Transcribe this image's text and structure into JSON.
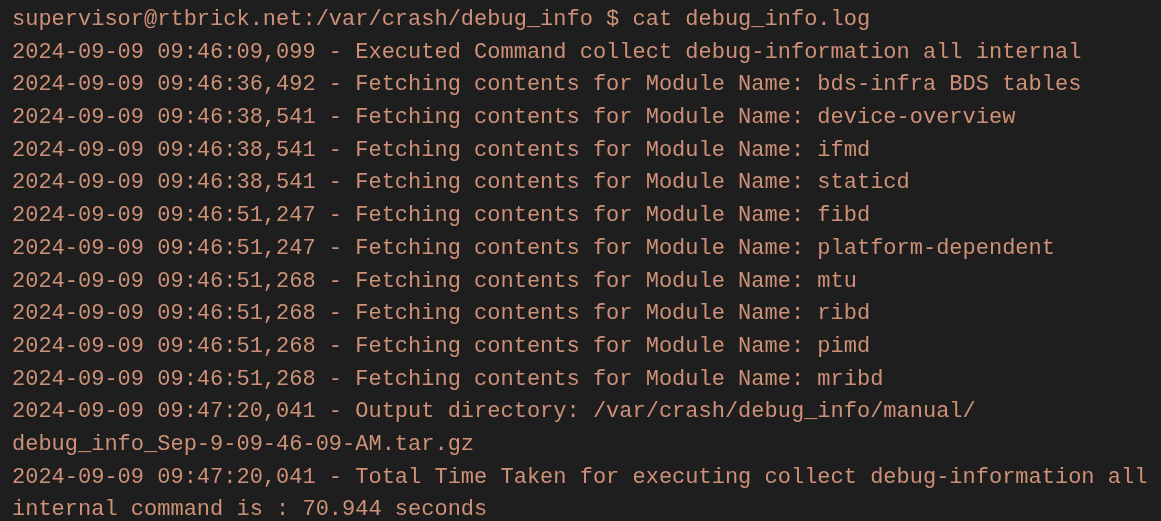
{
  "terminal": {
    "lines": [
      "supervisor@rtbrick.net:/var/crash/debug_info $ cat debug_info.log",
      "2024-09-09 09:46:09,099 - Executed Command collect debug-information all internal",
      "2024-09-09 09:46:36,492 - Fetching contents for Module Name: bds-infra BDS tables",
      "2024-09-09 09:46:38,541 - Fetching contents for Module Name: device-overview",
      "2024-09-09 09:46:38,541 - Fetching contents for Module Name: ifmd",
      "2024-09-09 09:46:38,541 - Fetching contents for Module Name: staticd",
      "2024-09-09 09:46:51,247 - Fetching contents for Module Name: fibd",
      "2024-09-09 09:46:51,247 - Fetching contents for Module Name: platform-dependent",
      "2024-09-09 09:46:51,268 - Fetching contents for Module Name: mtu",
      "2024-09-09 09:46:51,268 - Fetching contents for Module Name: ribd",
      "2024-09-09 09:46:51,268 - Fetching contents for Module Name: pimd",
      "2024-09-09 09:46:51,268 - Fetching contents for Module Name: mribd",
      "2024-09-09 09:47:20,041 - Output directory: /var/crash/debug_info/manual/",
      "debug_info_Sep-9-09-46-09-AM.tar.gz",
      "2024-09-09 09:47:20,041 - Total Time Taken for executing collect debug-information all",
      "internal command is : 70.944 seconds"
    ]
  }
}
